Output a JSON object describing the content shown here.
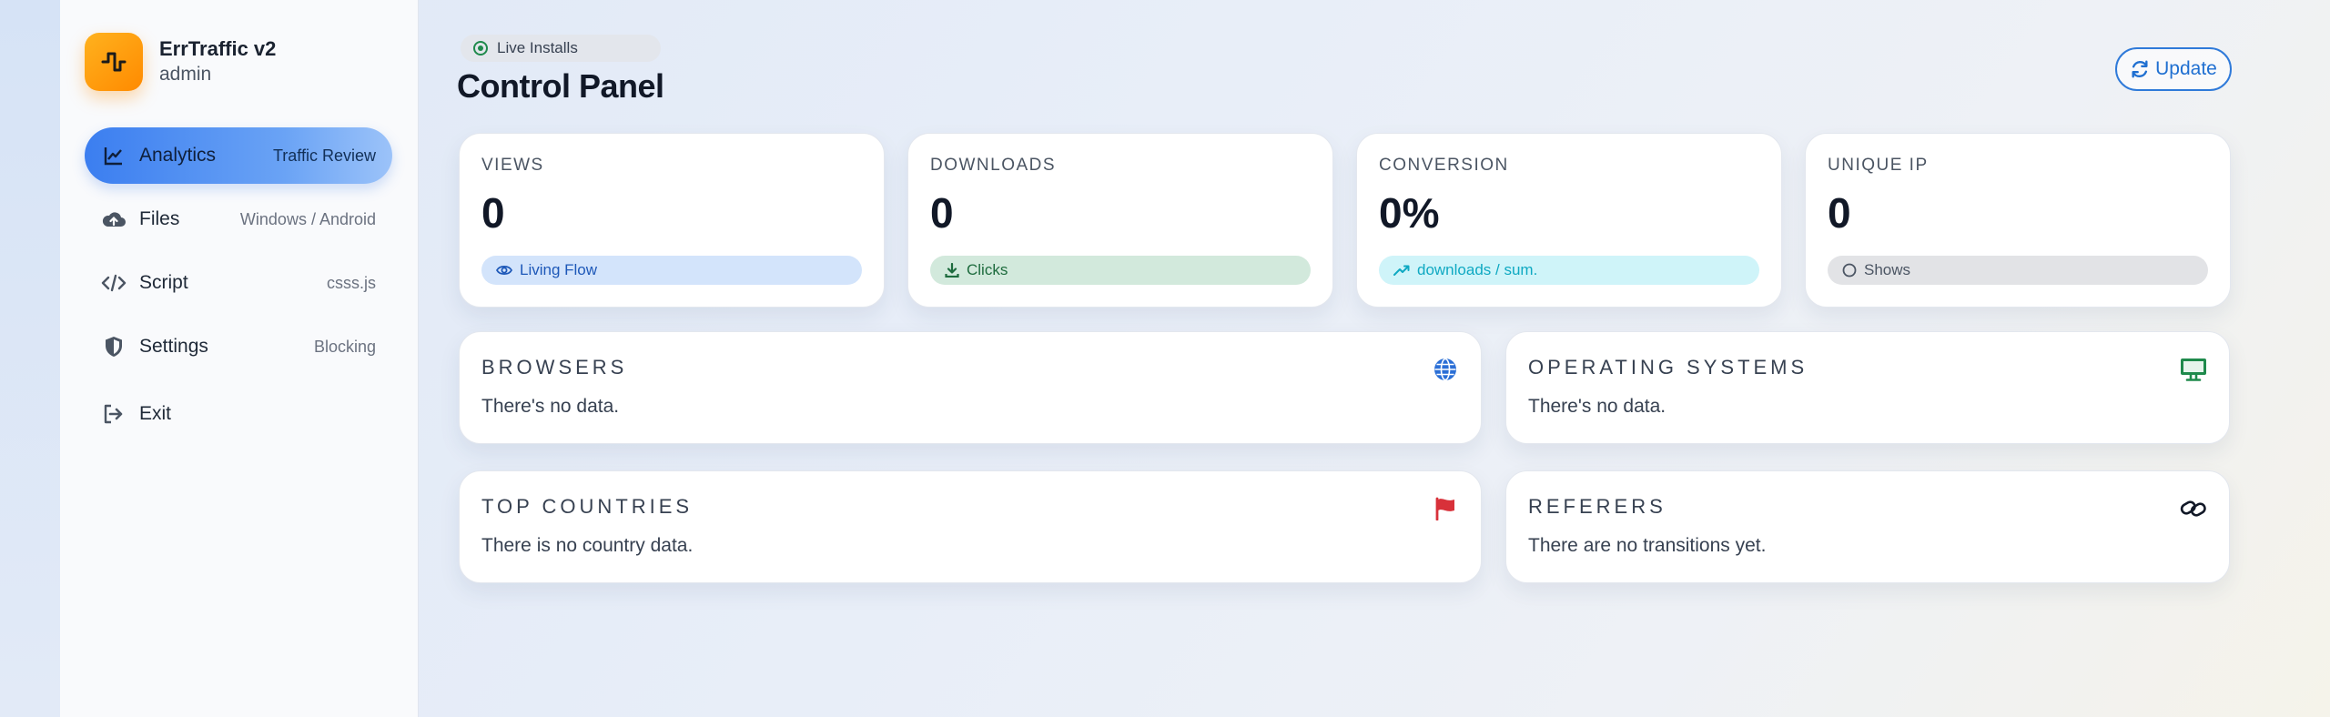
{
  "brand": {
    "title": "ErrTraffic v2",
    "subtitle": "admin",
    "logo_icon": "pulse-icon",
    "accent": "#ff9a10"
  },
  "sidebar": {
    "items": [
      {
        "label": "Analytics",
        "hint": "Traffic Review",
        "icon": "chart-line-icon",
        "active": true
      },
      {
        "label": "Files",
        "hint": "Windows / Android",
        "icon": "cloud-upload-icon",
        "active": false
      },
      {
        "label": "Script",
        "hint": "csss.js",
        "icon": "code-icon",
        "active": false
      },
      {
        "label": "Settings",
        "hint": "Blocking",
        "icon": "shield-icon",
        "active": false
      }
    ],
    "exit_label": "Exit"
  },
  "header": {
    "status_label": "Live Installs",
    "title": "Control Panel",
    "update_label": "Update"
  },
  "stats": [
    {
      "label": "VIEWS",
      "value": "0",
      "chip": "Living Flow",
      "chip_icon": "eye-icon",
      "chip_color": "#d3e4fb"
    },
    {
      "label": "DOWNLOADS",
      "value": "0",
      "chip": "Clicks",
      "chip_icon": "download-icon",
      "chip_color": "#d2e9dc"
    },
    {
      "label": "CONVERSION",
      "value": "0%",
      "chip": "downloads / sum.",
      "chip_icon": "trend-up-icon",
      "chip_color": "#cff4f9"
    },
    {
      "label": "UNIQUE IP",
      "value": "0",
      "chip": "Shows",
      "chip_icon": "circle-icon",
      "chip_color": "#e2e3e6"
    }
  ],
  "panels": [
    {
      "title": "BROWSERS",
      "text": "There's no data.",
      "icon": "globe-icon",
      "icon_color": "#2b6fd6"
    },
    {
      "title": "OPERATING SYSTEMS",
      "text": "There's no data.",
      "icon": "monitor-icon",
      "icon_color": "#1f8a4c"
    },
    {
      "title": "TOP COUNTRIES",
      "text": "There is no country data.",
      "icon": "flag-icon",
      "icon_color": "#d8313a"
    },
    {
      "title": "REFERERS",
      "text": "There are no transitions yet.",
      "icon": "link-icon",
      "icon_color": "#111827"
    }
  ]
}
